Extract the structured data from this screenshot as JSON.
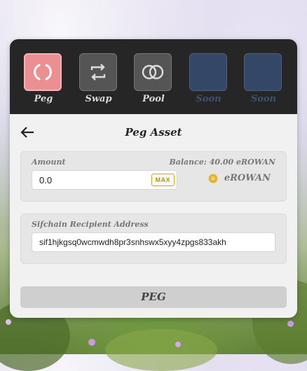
{
  "nav": {
    "items": [
      {
        "label": "Peg",
        "icon": "peg-icon",
        "state": "active"
      },
      {
        "label": "Swap",
        "icon": "swap-icon",
        "state": "default"
      },
      {
        "label": "Pool",
        "icon": "pool-icon",
        "state": "default"
      },
      {
        "label": "Soon",
        "icon": "",
        "state": "disabled"
      },
      {
        "label": "Soon",
        "icon": "",
        "state": "disabled"
      }
    ]
  },
  "header": {
    "title": "Peg Asset",
    "back_icon": "arrow-left-icon"
  },
  "amount": {
    "label": "Amount",
    "value": "0.0",
    "max_label": "MAX",
    "balance_text": "Balance: 40.00 eROWAN",
    "token_name": "eROWAN",
    "token_icon": "coin-icon"
  },
  "address": {
    "label": "Sifchain Recipient Address",
    "value": "sif1hjkgsq0wcmwdh8pr3snhswx5xyy4zpgs833akh"
  },
  "actions": {
    "peg_label": "PEG"
  },
  "colors": {
    "nav_bg": "#262626",
    "active_tile": "#ec8f92",
    "soon_tile": "#354766",
    "max_accent": "#c9a22f",
    "coin": "#e6b93a"
  }
}
